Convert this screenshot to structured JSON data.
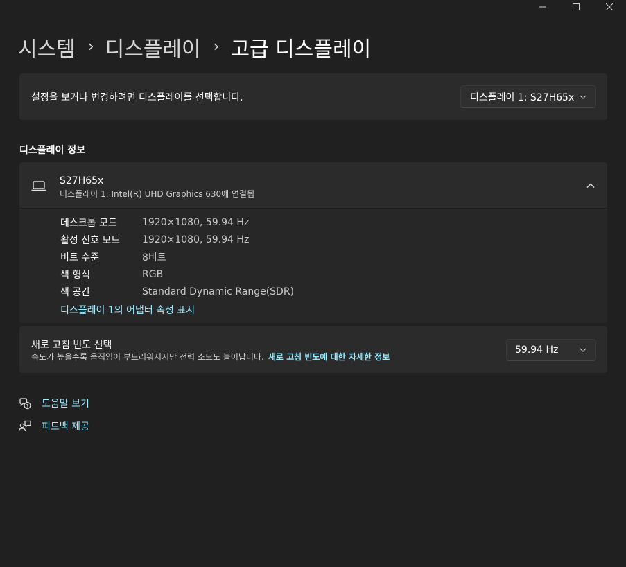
{
  "window": {
    "minimize_glyph": "—",
    "maximize_glyph": "☐",
    "close_glyph": "✕"
  },
  "breadcrumb": {
    "items": [
      "시스템",
      "디스플레이",
      "고급 디스플레이"
    ],
    "separator": "›"
  },
  "display_select": {
    "label": "설정을 보거나 변경하려면 디스플레이를 선택합니다.",
    "selected": "디스플레이 1: S27H65x"
  },
  "display_info": {
    "section_title": "디스플레이 정보",
    "monitor_name": "S27H65x",
    "monitor_subtitle": "디스플레이 1: Intel(R) UHD Graphics 630에 연결됨",
    "properties": [
      {
        "key": "데스크톱 모드",
        "value": "1920×1080, 59.94 Hz"
      },
      {
        "key": "활성 신호 모드",
        "value": "1920×1080, 59.94 Hz"
      },
      {
        "key": "비트 수준",
        "value": "8비트"
      },
      {
        "key": "색 형식",
        "value": "RGB"
      },
      {
        "key": "색 공간",
        "value": "Standard Dynamic Range(SDR)"
      }
    ],
    "adapter_link": "디스플레이 1의 어댑터 속성 표시"
  },
  "refresh_rate": {
    "title": "새로 고침 빈도 선택",
    "description": "속도가 높을수록 움직임이 부드러워지지만 전력 소모도 늘어납니다.",
    "learn_more_link": "새로 고침 빈도에 대한 자세한 정보",
    "selected": "59.94 Hz"
  },
  "footer_links": {
    "help": "도움말 보기",
    "feedback": "피드백 제공"
  },
  "colors": {
    "background": "#202020",
    "card": "#2b2b2b",
    "accent_link": "#99ebff"
  }
}
